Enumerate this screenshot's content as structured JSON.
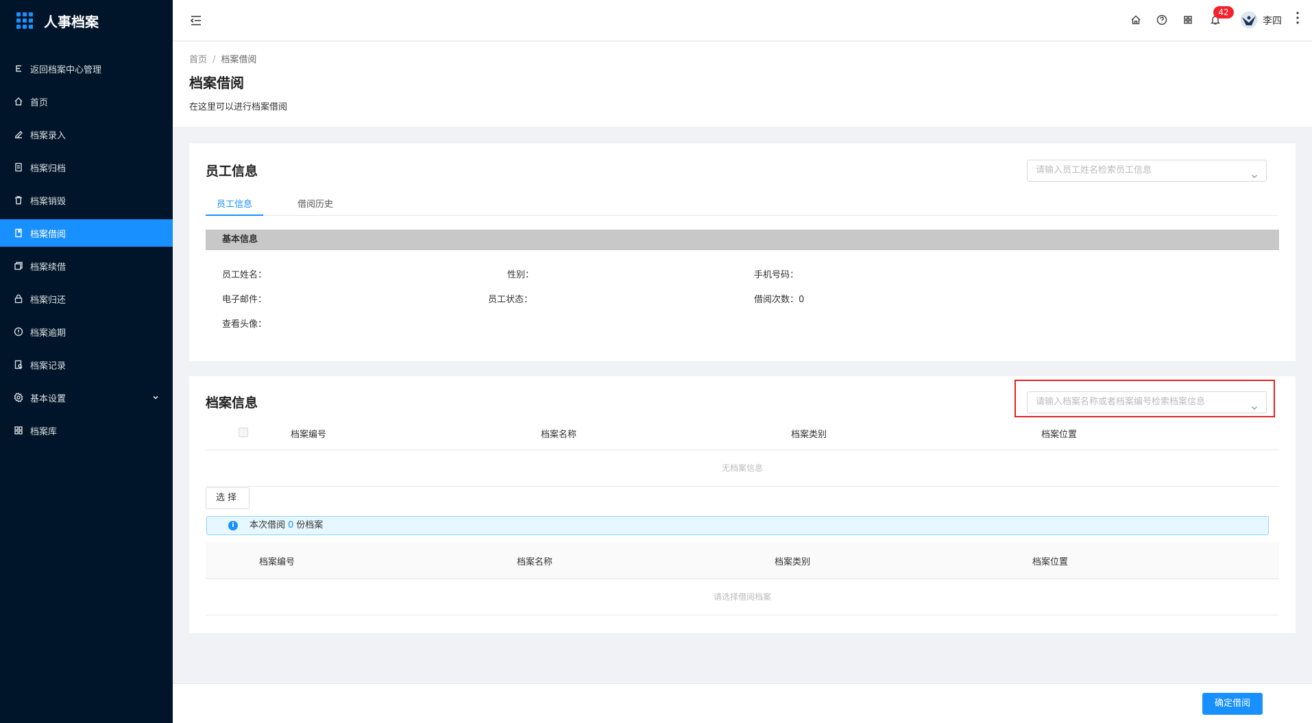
{
  "app": {
    "title": "人事档案"
  },
  "sidebar": {
    "items": [
      {
        "label": "返回档案中心管理",
        "icon": "return-icon"
      },
      {
        "label": "首页",
        "icon": "home-icon"
      },
      {
        "label": "档案录入",
        "icon": "edit-icon"
      },
      {
        "label": "档案归档",
        "icon": "archive-icon"
      },
      {
        "label": "档案销毁",
        "icon": "trash-icon"
      },
      {
        "label": "档案借阅",
        "icon": "book-icon",
        "active": true
      },
      {
        "label": "档案续借",
        "icon": "copy-icon"
      },
      {
        "label": "档案归还",
        "icon": "lock-icon"
      },
      {
        "label": "档案逾期",
        "icon": "alert-circle-icon"
      },
      {
        "label": "档案记录",
        "icon": "record-icon"
      },
      {
        "label": "基本设置",
        "icon": "gear-icon",
        "has_submenu": true
      },
      {
        "label": "档案库",
        "icon": "grid-icon"
      }
    ]
  },
  "header": {
    "notification_count": "42",
    "username": "李四"
  },
  "page": {
    "breadcrumb": [
      "首页",
      "档案借阅"
    ],
    "title": "档案借阅",
    "description": "在这里可以进行档案借阅"
  },
  "employee_card": {
    "title": "员工信息",
    "search_placeholder": "请输入员工姓名检索员工信息",
    "tabs": [
      "员工信息",
      "借阅历史"
    ],
    "section_title": "基本信息",
    "fields": {
      "name": "员工姓名：",
      "gender": "性别：",
      "phone": "手机号码：",
      "email": "电子邮件：",
      "status": "员工状态：",
      "borrow_count_label": "借阅次数：",
      "borrow_count_value": "0",
      "avatar": "查看头像："
    }
  },
  "archive_card": {
    "title": "档案信息",
    "search_placeholder": "请输入档案名称或者档案编号检索档案信息",
    "table1_headers": [
      "档案编号",
      "档案名称",
      "档案类别",
      "档案位置"
    ],
    "table1_empty": "无档案信息",
    "select_button": "选择",
    "alert_prefix": "本次借阅",
    "alert_count": "0",
    "alert_suffix": "份档案",
    "table2_headers": [
      "档案编号",
      "档案名称",
      "档案类别",
      "档案位置"
    ],
    "table2_empty": "请选择借阅档案"
  },
  "footer": {
    "confirm_button": "确定借阅"
  },
  "colors": {
    "primary": "#1890ff",
    "sidebar_bg": "#001529",
    "badge": "#f5222d",
    "highlight": "#e02020"
  }
}
